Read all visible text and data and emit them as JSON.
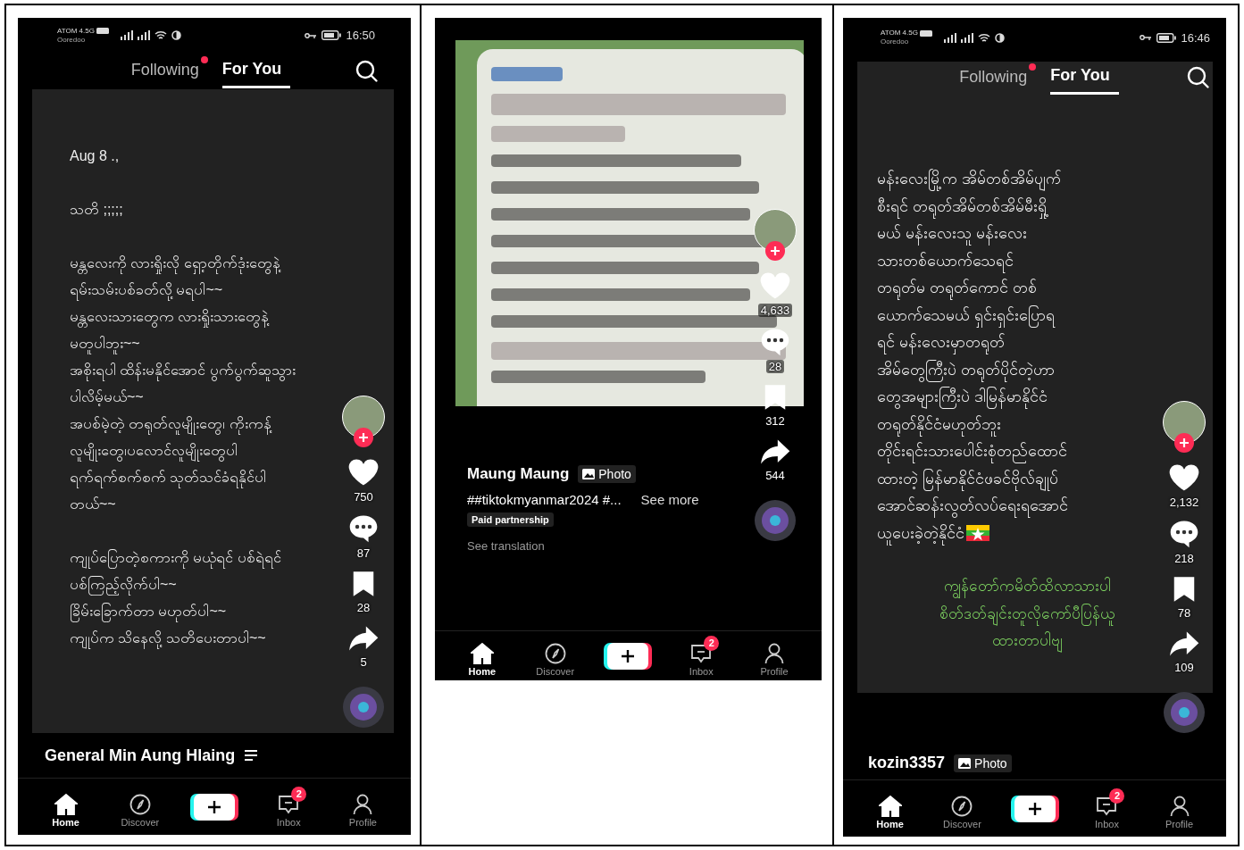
{
  "phones": [
    {
      "kind": "text_post",
      "status_bar": {
        "carrier": "ATOM 4.5G",
        "operator": "Ooredoo",
        "time": "16:50"
      },
      "top_tabs": [
        {
          "label": "Following",
          "selected": false,
          "dot": true
        },
        {
          "label": "For You",
          "selected": true,
          "dot": false
        }
      ],
      "blocks": [
        {
          "kind": "plain",
          "lines": [
            "Aug 8 .,"
          ]
        },
        {
          "kind": "plain",
          "lines": [
            "သတိ ;;;;;"
          ]
        },
        {
          "kind": "plain",
          "lines": [
            "မန္တလေးကို လားရှိုးလို ရှော့တိုက်ဒုံးတွေနဲ့",
            "ရမ်းသမ်းပစ်ခတ်လို့ မရပါ~~",
            "မန္တလေးသားတွေက လားရှိုးသားတွေနဲ့",
            "မတူပါဘူး~~",
            "အစိုးရပါ ထိန်းမနိုင်အောင် ပွက်ပွက်ဆူသွား",
            "ပါလိမ့်မယ်~~",
            "အပစ်မဲ့တဲ့ တရုတ်လူမျိုးတွေ၊ ကိုးကန့်",
            "လူမျိုးတွေ၊ပလောင်လူမျိုးတွေပါ",
            "ရက်ရက်စက်စက် သုတ်သင်ခံရနိုင်ပါ",
            "တယ်~~"
          ]
        },
        {
          "kind": "plain",
          "lines": [
            "ကျုပ်ပြောတဲ့စကားကို မယုံရင် ပစ်ရဲရင်",
            "ပစ်ကြည့်လိုက်ပါ~~",
            "ခြိမ်းခြောက်တာ မဟုတ်ပါ~~",
            "ကျုပ်က သိနေလို့ သတိပေးတာပါ~~"
          ]
        }
      ],
      "actions": {
        "likes": "750",
        "comments": "87",
        "saves": "28",
        "shares": "5"
      },
      "caption": {
        "author": "General Min Aung Hlaing",
        "playlist": true
      },
      "nav": [
        {
          "kind": "home",
          "label": "Home",
          "selected": true
        },
        {
          "kind": "discover",
          "label": "Discover",
          "selected": false
        },
        {
          "kind": "create"
        },
        {
          "kind": "inbox",
          "label": "Inbox",
          "badge": "2",
          "selected": false
        },
        {
          "kind": "profile",
          "label": "Profile",
          "selected": false
        }
      ]
    },
    {
      "kind": "photo_post",
      "actions": {
        "likes": "4,633",
        "comments": "28",
        "saves": "312",
        "shares": "544"
      },
      "caption": {
        "author": "Maung Maung",
        "badge": "Photo",
        "hashtags": "##tiktokmyanmar2024 #...",
        "see_more": "See more",
        "tag": "Paid partnership",
        "translation": "See translation"
      },
      "nav": [
        {
          "kind": "home",
          "label": "Home",
          "selected": true
        },
        {
          "kind": "discover",
          "label": "Discover",
          "selected": false
        },
        {
          "kind": "create"
        },
        {
          "kind": "inbox",
          "label": "Inbox",
          "badge": "2",
          "selected": false
        },
        {
          "kind": "profile",
          "label": "Profile",
          "selected": false
        }
      ]
    },
    {
      "kind": "text_post",
      "status_bar": {
        "carrier": "ATOM 4.5G",
        "operator": "Ooredoo",
        "time": "16:46"
      },
      "top_tabs": [
        {
          "label": "Following",
          "selected": false,
          "dot": true
        },
        {
          "label": "For You",
          "selected": true,
          "dot": false
        }
      ],
      "blocks": [
        {
          "kind": "plain",
          "trailing_flag": true,
          "lines": [
            "မန်းလေးမြို့က အိမ်တစ်အိမ်ပျက်",
            "စီးရင် တရုတ်အိမ်တစ်အိမ်မီးရှို့",
            "မယ် မန်းလေးသူ မန်းလေး",
            "သားတစ်ယောက်သေရင်",
            "တရုတ်မ တရုတ်ကောင် တစ်",
            "ယောက်သေမယ် ရှင်းရှင်းပြောရ",
            "ရင် မန်းလေးမှာတရုတ်",
            "အိမ်တွေကြီးပဲ တရုတ်ပိုင်တဲ့ဟာ",
            "တွေအများကြီးပဲ ဒါမြန်မာနိုင်ငံ",
            "တရုတ်နိုင်ငံမဟုတ်ဘူး",
            "တိုင်းရင်းသားပေါင်းစုံတည်ထောင်",
            "ထားတဲ့ မြန်မာနိုင်ငံဖခင်ဗိုလ်ချုပ်",
            "အောင်ဆန်းလွတ်လပ်ရေးရအောင်",
            "ယူပေးခဲ့တဲ့နိုင်ငံ"
          ]
        },
        {
          "kind": "accent",
          "lines": [
            "ကျွန်တော်ကမိတ်ထိလာသားပါ",
            "စိတ်ဒတ်ချင်းတူလိုကော်ပီပြန်ယူ",
            "ထားတာပါဗျ"
          ]
        }
      ],
      "actions": {
        "likes": "2,132",
        "comments": "218",
        "saves": "78",
        "shares": "109"
      },
      "caption": {
        "author": "kozin3357",
        "badge": "Photo"
      },
      "nav": [
        {
          "kind": "home",
          "label": "Home",
          "selected": true
        },
        {
          "kind": "discover",
          "label": "Discover",
          "selected": false
        },
        {
          "kind": "create"
        },
        {
          "kind": "inbox",
          "label": "Inbox",
          "badge": "2",
          "selected": false
        },
        {
          "kind": "profile",
          "label": "Profile",
          "selected": false
        }
      ]
    }
  ]
}
